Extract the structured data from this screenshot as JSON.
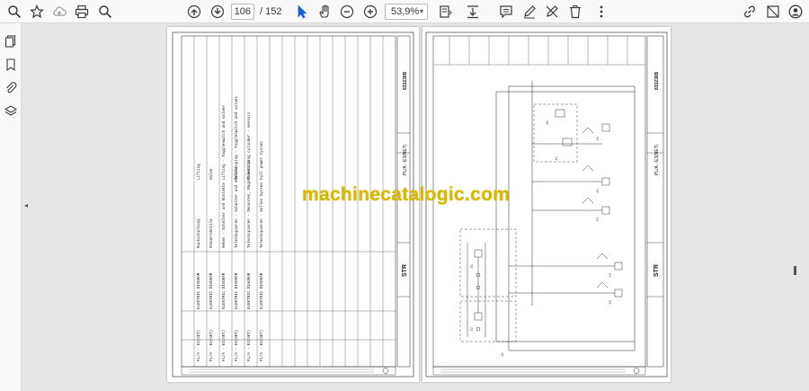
{
  "toolbar": {
    "page_current": "106",
    "page_total": "/ 152",
    "zoom": "53,9%"
  },
  "watermark": "machinecatalogic.com",
  "left_page": {
    "doc_number": "833238B",
    "drawing_labels": [
      "STR",
      "PL/A - E3(NET)"
    ],
    "table_rows": [
      {
        "no": "1",
        "sheet": "PL/A - E3(NET)",
        "type": "ELEKTRIC DIAGRAM",
        "desc": "Ruckschaltung",
        "note": "Lifting"
      },
      {
        "no": "2",
        "sheet": "PL/A - E3(NET)",
        "type": "ELEKTRIC DIAGRAM",
        "desc": "Steuerventile",
        "note": "Valve"
      },
      {
        "no": "3",
        "sheet": "PL/A - E3(NET)",
        "type": "ELEKTRIC DIAGRAM",
        "desc": "Heben - Schalter und Kontakte",
        "note": "Lifting - Toggleswitch and valves"
      },
      {
        "no": "4",
        "sheet": "PL/A - E3(NET)",
        "type": "ELEKTRIC DIAGRAM",
        "desc": "Teleskopieren - Schalter und Ventile",
        "note": "Telescoping - Toggleswitch and valves"
      },
      {
        "no": "5",
        "sheet": "PL/A - E3(NET)",
        "type": "ELEKTRIC DIAGRAM",
        "desc": "Teleskopieren - Sensoren, Magnetventile",
        "note": "Telescoping cylinder - sensors"
      },
      {
        "no": "6",
        "sheet": "PL/A - E3(NET)",
        "type": "ELEKTRIC DIAGRAM",
        "desc": "Teleskopieren - Volles System",
        "note": "Full power system"
      }
    ]
  },
  "right_page": {
    "doc_number": "833238B",
    "drawing_labels": [
      "STR",
      "PL/A - E3(NET)"
    ]
  }
}
